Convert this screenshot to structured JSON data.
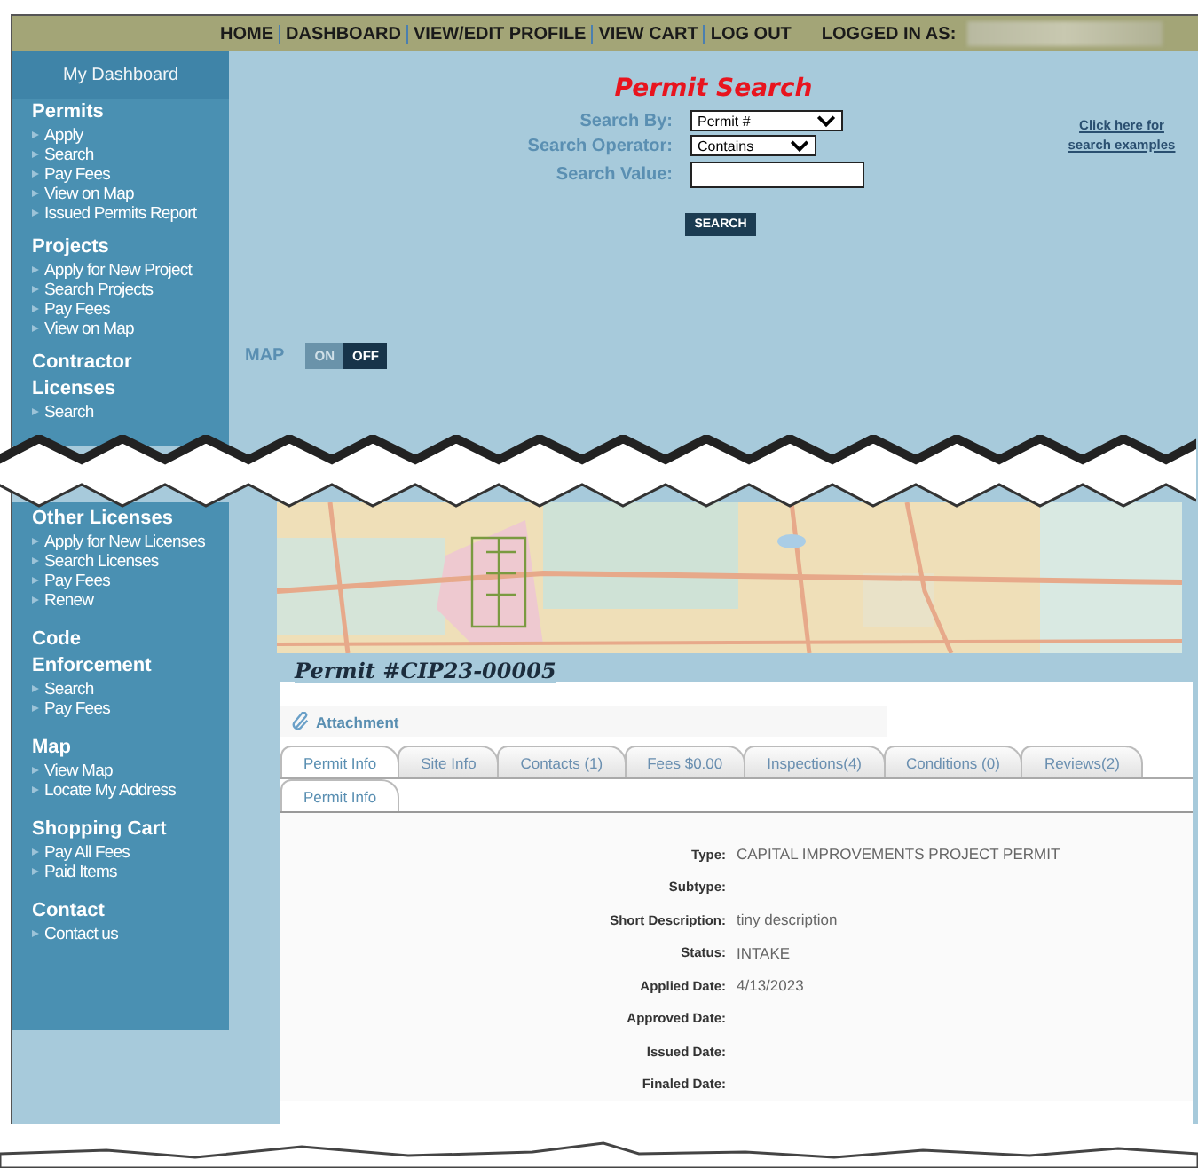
{
  "nav": {
    "links": [
      "HOME",
      "DASHBOARD",
      "VIEW/EDIT PROFILE",
      "VIEW CART",
      "LOG OUT"
    ],
    "logged_in_label": "LOGGED IN AS:"
  },
  "sidebar_top": {
    "dashboard": "My Dashboard",
    "groups": [
      {
        "title": "Permits",
        "items": [
          "Apply",
          "Search",
          "Pay Fees",
          "View on Map",
          "Issued Permits Report"
        ]
      },
      {
        "title": "Projects",
        "items": [
          "Apply for New Project",
          "Search Projects",
          "Pay Fees",
          "View on Map"
        ]
      },
      {
        "title": "Contractor Licenses",
        "items": [
          "Search"
        ]
      }
    ]
  },
  "search": {
    "title": "Permit Search",
    "fields": [
      {
        "label": "Search By:",
        "kind": "select",
        "value": "Permit #"
      },
      {
        "label": "Search Operator:",
        "kind": "select",
        "value": "Contains"
      },
      {
        "label": "Search Value:",
        "kind": "input"
      }
    ],
    "button": "SEARCH",
    "examples_link": "Click here for search examples"
  },
  "map_toggle": {
    "label": "MAP",
    "options": [
      {
        "label": "ON",
        "selected": false
      },
      {
        "label": "OFF",
        "selected": true
      }
    ]
  },
  "sidebar_bottom": {
    "groups": [
      {
        "title": "Other Licenses",
        "items": [
          "Apply for New Licenses",
          "Search Licenses",
          "Pay Fees",
          "Renew"
        ]
      },
      {
        "title": "Code Enforcement",
        "items": [
          "Search",
          "Pay Fees"
        ]
      },
      {
        "title": "Map",
        "items": [
          "View Map",
          "Locate My Address"
        ]
      },
      {
        "title": "Shopping Cart",
        "items": [
          "Pay All Fees",
          "Paid Items"
        ]
      },
      {
        "title": "Contact",
        "items": [
          "Contact us"
        ]
      }
    ]
  },
  "permit": {
    "title": "Permit #CIP23-00005",
    "attachment": "Attachment",
    "tabs": [
      {
        "label": "Permit Info",
        "selected": true
      },
      {
        "label": "Site Info",
        "selected": false
      },
      {
        "label": "Contacts (1)",
        "selected": false
      },
      {
        "label": "Fees $0.00",
        "selected": false
      },
      {
        "label": "Inspections(4)",
        "selected": false
      },
      {
        "label": "Conditions (0)",
        "selected": false
      },
      {
        "label": "Reviews(2)",
        "selected": false
      }
    ],
    "subtabs": [
      {
        "label": "Permit Info",
        "selected": true
      }
    ],
    "details": [
      {
        "label": "Type:",
        "value": "CAPITAL IMPROVEMENTS PROJECT PERMIT"
      },
      {
        "label": "Subtype:"
      },
      {
        "label": "Short Description:",
        "value": "tiny description"
      },
      {
        "label": "Status:",
        "value": "INTAKE"
      },
      {
        "label": "Applied Date:",
        "value": "4/13/2023"
      },
      {
        "label": "Approved Date:"
      },
      {
        "label": "Issued Date:"
      },
      {
        "label": "Finaled Date:"
      }
    ]
  }
}
